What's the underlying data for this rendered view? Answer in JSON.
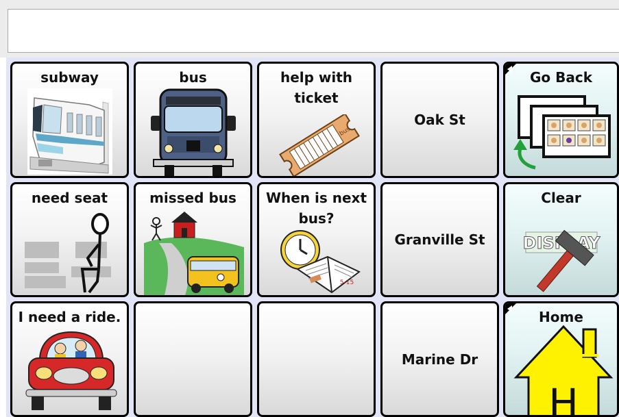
{
  "message_bar": {
    "value": ""
  },
  "cells": {
    "subway": "subway",
    "bus": "bus",
    "help_ticket": [
      "help with",
      "ticket"
    ],
    "oak_st": "Oak St",
    "go_back": "Go Back",
    "need_seat": "need seat",
    "missed_bus": "missed bus",
    "next_bus": [
      "When is next",
      "bus?"
    ],
    "granville_st": "Granville St",
    "clear": "Clear",
    "need_ride": "I need a ride.",
    "empty_1": "",
    "empty_2": "",
    "marine_dr": "Marine Dr",
    "home": "Home"
  },
  "images": {
    "display_sign": "DISPLAY",
    "ticket_text": "bus",
    "home_letter": "H",
    "calendar_date": "5-15"
  },
  "colors": {
    "grid_background": "#e2e5f8",
    "nav_cell": "#e2f2f2",
    "normal_cell": "#f3f3f3",
    "border": "#000000"
  }
}
